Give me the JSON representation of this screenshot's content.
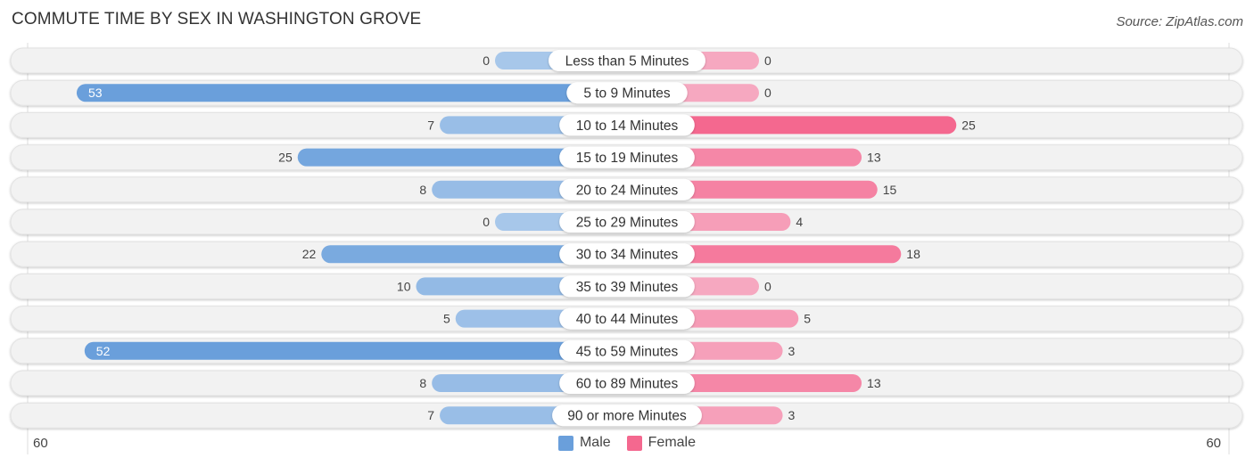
{
  "header": {
    "title": "COMMUTE TIME BY SEX IN WASHINGTON GROVE",
    "source": "Source: ZipAtlas.com"
  },
  "colors": {
    "male": "#6a9fdb",
    "male_light": "#a7c7ea",
    "female": "#f4688f",
    "female_light": "#f6a8c0",
    "track": "#f2f2f2"
  },
  "chart_data": {
    "type": "bar",
    "orientation": "horizontal-diverging",
    "title": "COMMUTE TIME BY SEX IN WASHINGTON GROVE",
    "categories": [
      "Less than 5 Minutes",
      "5 to 9 Minutes",
      "10 to 14 Minutes",
      "15 to 19 Minutes",
      "20 to 24 Minutes",
      "25 to 29 Minutes",
      "30 to 34 Minutes",
      "35 to 39 Minutes",
      "40 to 44 Minutes",
      "45 to 59 Minutes",
      "60 to 89 Minutes",
      "90 or more Minutes"
    ],
    "series": [
      {
        "name": "Male",
        "values": [
          0,
          53,
          7,
          25,
          8,
          0,
          22,
          10,
          5,
          52,
          8,
          7
        ]
      },
      {
        "name": "Female",
        "values": [
          0,
          0,
          25,
          13,
          15,
          4,
          18,
          0,
          5,
          3,
          13,
          3
        ]
      }
    ],
    "xlim": [
      60,
      60
    ],
    "axis_labels": {
      "left": "60",
      "right": "60"
    },
    "legend": {
      "position": "bottom-center",
      "entries": [
        "Male",
        "Female"
      ]
    }
  }
}
